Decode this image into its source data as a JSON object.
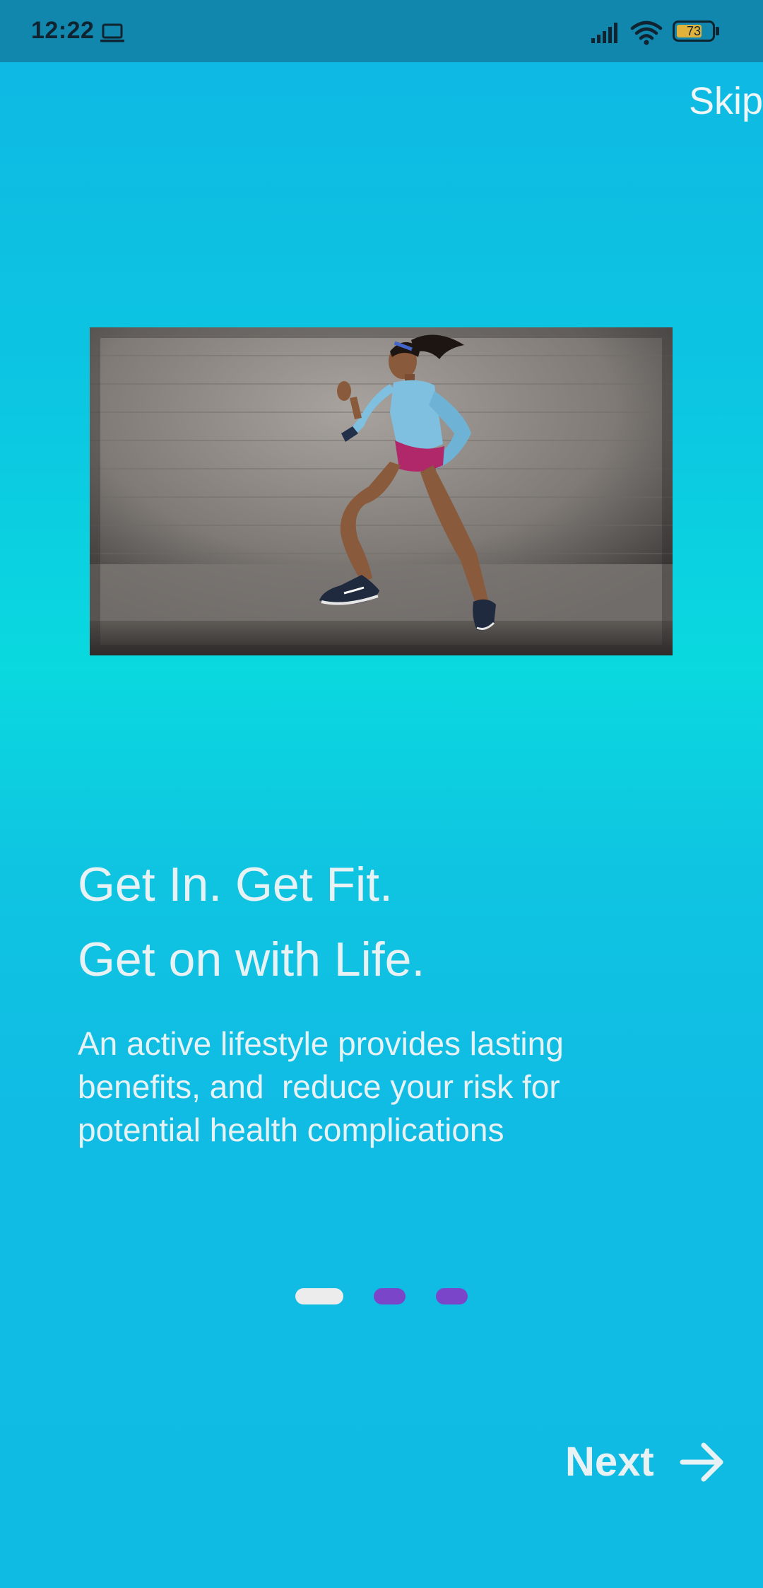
{
  "status_bar": {
    "time": "12:22",
    "battery_level": 73,
    "battery_text": "73"
  },
  "skip": {
    "label": "Skip"
  },
  "onboarding": {
    "headline_line1": "Get In. Get Fit.",
    "headline_line2": "Get on with Life.",
    "description": "An active lifestyle provides lasting benefits, and  reduce your risk for potential health complications"
  },
  "pager": {
    "total": 3,
    "active_index": 0,
    "active_color": "#ececec",
    "inactive_color": "#7b45c9"
  },
  "next": {
    "label": "Next"
  },
  "colors": {
    "status_bar": "#1187ad",
    "background_top": "#0fb7e3",
    "background_mid": "#0ad9df",
    "text": "#e8f2f4"
  }
}
